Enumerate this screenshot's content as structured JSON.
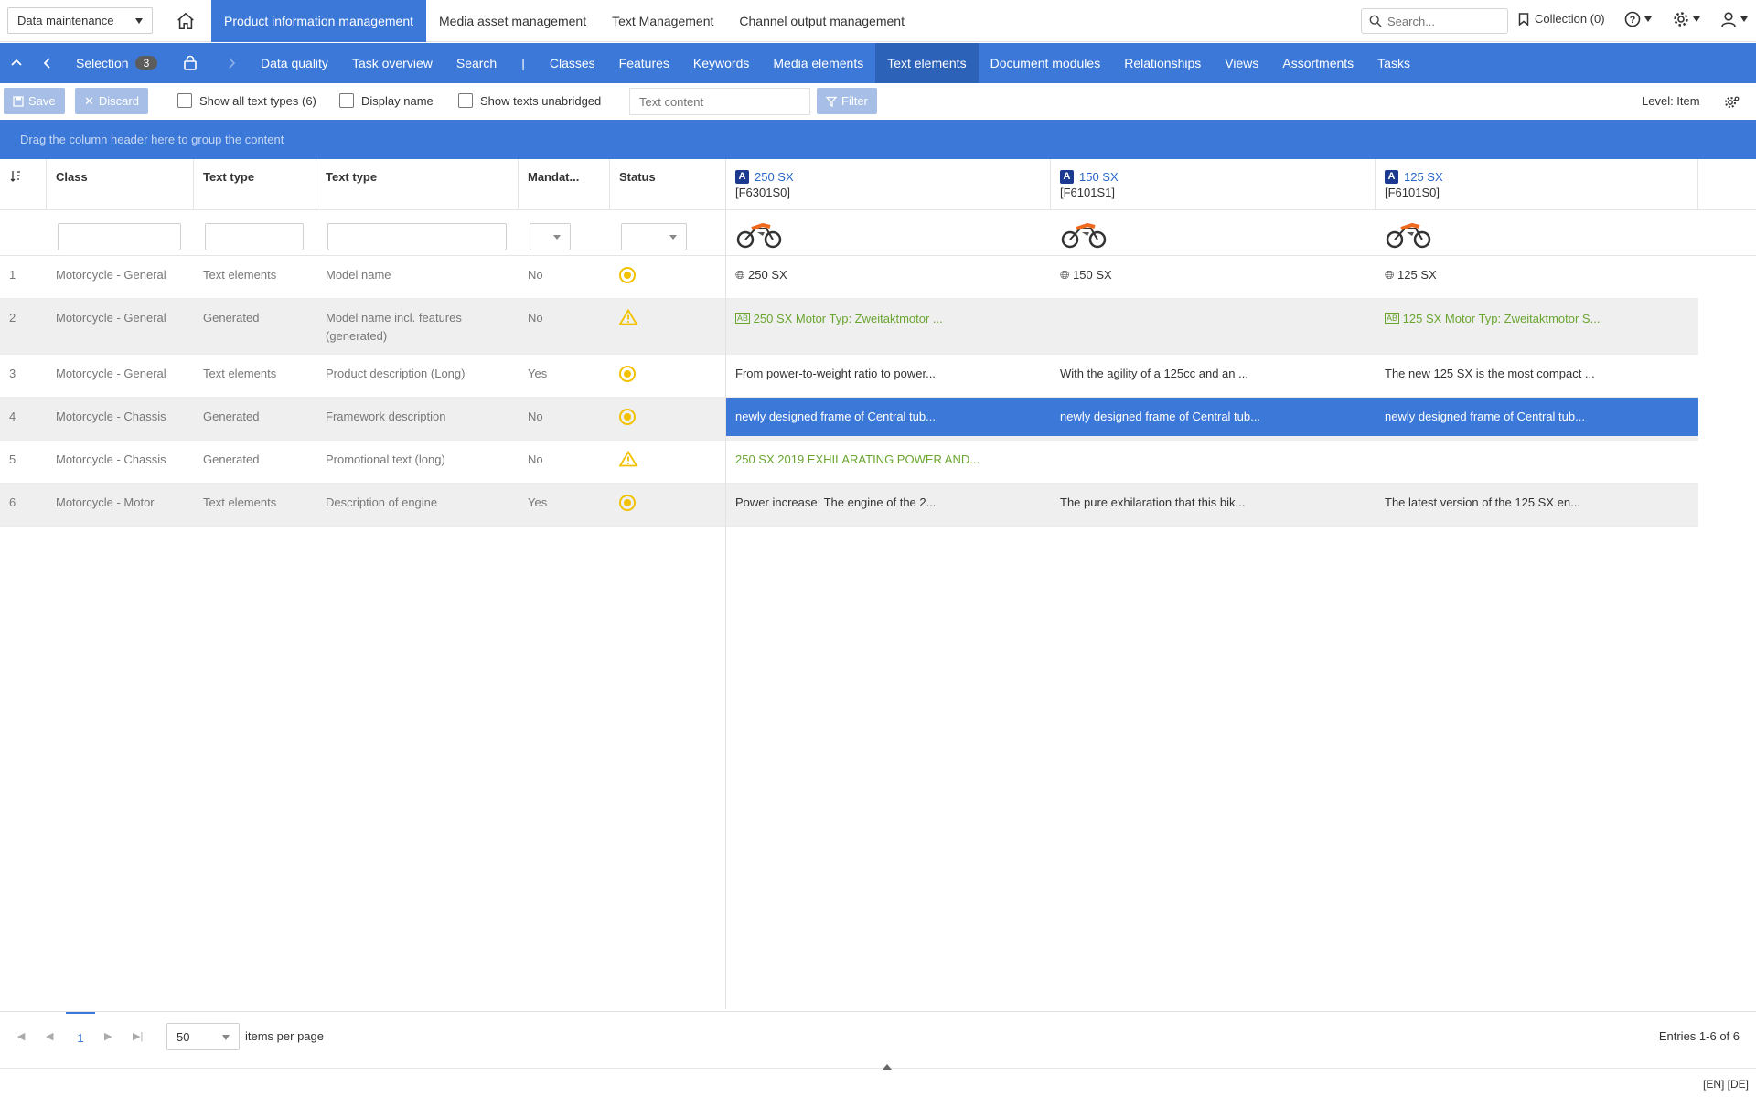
{
  "topbar": {
    "module_select": "Data maintenance",
    "tabs": [
      {
        "label": "Product information management",
        "active": true
      },
      {
        "label": "Media asset management",
        "active": false
      },
      {
        "label": "Text Management",
        "active": false
      },
      {
        "label": "Channel output management",
        "active": false
      }
    ],
    "search_placeholder": "Search...",
    "collection_label": "Collection (0)"
  },
  "nav": {
    "selection_label": "Selection",
    "selection_count": "3",
    "separator": "|",
    "items": [
      {
        "label": "Data quality"
      },
      {
        "label": "Task overview"
      },
      {
        "label": "Search"
      },
      {
        "label": "Classes"
      },
      {
        "label": "Features"
      },
      {
        "label": "Keywords"
      },
      {
        "label": "Media elements"
      },
      {
        "label": "Text elements",
        "active": true
      },
      {
        "label": "Document modules"
      },
      {
        "label": "Relationships"
      },
      {
        "label": "Views"
      },
      {
        "label": "Assortments"
      },
      {
        "label": "Tasks"
      }
    ]
  },
  "toolbar": {
    "save_label": "Save",
    "discard_label": "Discard",
    "show_all_text_types": "Show all text types (6)",
    "display_name": "Display name",
    "show_unabridged": "Show texts unabridged",
    "text_content_placeholder": "Text content",
    "filter_label": "Filter",
    "level_label": "Level: Item"
  },
  "groupbar": {
    "hint": "Drag the column header here to group the content"
  },
  "grid": {
    "columns": {
      "class": "Class",
      "text_type_1": "Text type",
      "text_type_2": "Text type",
      "mandatory": "Mandat...",
      "status": "Status"
    },
    "products": [
      {
        "name": "250 SX",
        "code": "[F6301S0]"
      },
      {
        "name": "150 SX",
        "code": "[F6101S1]"
      },
      {
        "name": "125 SX",
        "code": "[F6101S0]"
      }
    ],
    "rows": [
      {
        "num": "1",
        "class": "Motorcycle - General",
        "source": "Text elements",
        "text_type": "Model name",
        "mandatory": "No",
        "status": "ok",
        "values": [
          "250 SX",
          "150 SX",
          "125 SX"
        ]
      },
      {
        "num": "2",
        "class": "Motorcycle - General",
        "source": "Generated",
        "text_type": "Model name incl. features (generated)",
        "mandatory": "No",
        "status": "warning",
        "values": [
          "250 SX Motor Typ: Zweitaktmotor ...",
          "",
          "125 SX Motor Typ: Zweitaktmotor S..."
        ]
      },
      {
        "num": "3",
        "class": "Motorcycle - General",
        "source": "Text elements",
        "text_type": "Product description (Long)",
        "mandatory": "Yes",
        "status": "ok",
        "values": [
          "From power-to-weight ratio to power...",
          "With the agility of a 125cc and an ...",
          "The new 125 SX is the most compact ..."
        ]
      },
      {
        "num": "4",
        "class": "Motorcycle - Chassis",
        "source": "Generated",
        "text_type": "Framework description",
        "mandatory": "No",
        "status": "ok",
        "values": [
          "newly designed frame of Central tub...",
          "newly designed frame of Central tub...",
          "newly designed frame of Central tub..."
        ]
      },
      {
        "num": "5",
        "class": "Motorcycle - Chassis",
        "source": "Generated",
        "text_type": "Promotional text (long)",
        "mandatory": "No",
        "status": "warning",
        "values": [
          "250 SX 2019 EXHILARATING POWER AND...",
          "",
          ""
        ]
      },
      {
        "num": "6",
        "class": "Motorcycle - Motor",
        "source": "Text elements",
        "text_type": "Description of engine",
        "mandatory": "Yes",
        "status": "ok",
        "values": [
          "Power increase: The engine of the 2...",
          "The pure exhilaration that this bik...",
          "The latest version of the 125 SX en..."
        ]
      }
    ]
  },
  "footer": {
    "page": "1",
    "per_page": "50",
    "per_page_label": "items per page",
    "entries": "Entries 1-6 of 6",
    "languages": "[EN] [DE]"
  },
  "colors": {
    "accent": "#3c78d8",
    "active_nav": "#2d62b9",
    "generated_text": "#6aa52f",
    "status": "#f2c200"
  }
}
